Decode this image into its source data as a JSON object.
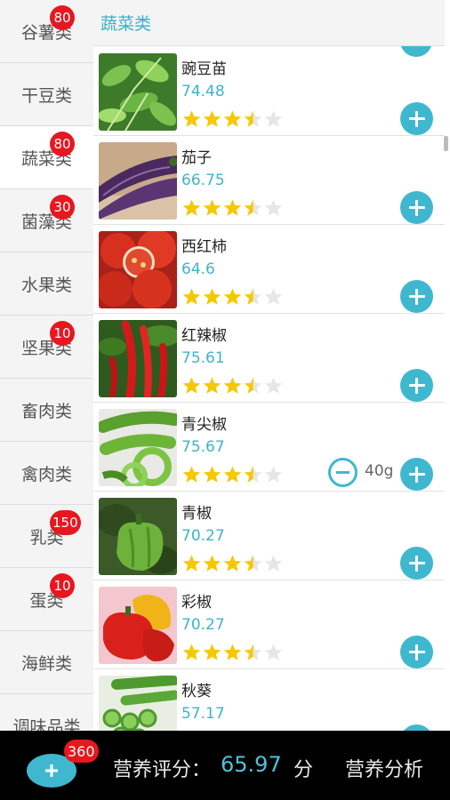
{
  "sidebar": {
    "categories": [
      {
        "label": "谷薯类",
        "badge": "80"
      },
      {
        "label": "干豆类",
        "badge": ""
      },
      {
        "label": "蔬菜类",
        "badge": "80"
      },
      {
        "label": "菌藻类",
        "badge": "30"
      },
      {
        "label": "水果类",
        "badge": ""
      },
      {
        "label": "坚果类",
        "badge": "10"
      },
      {
        "label": "畜肉类",
        "badge": ""
      },
      {
        "label": "禽肉类",
        "badge": ""
      },
      {
        "label": "乳类",
        "badge": "150"
      },
      {
        "label": "蛋类",
        "badge": "10"
      },
      {
        "label": "海鲜类",
        "badge": ""
      },
      {
        "label": "调味品类",
        "badge": ""
      }
    ],
    "active_index": 2
  },
  "main": {
    "section_title": "蔬菜类",
    "items": [
      {
        "name": "豌豆苗",
        "score": "74.48",
        "rating": 3.5
      },
      {
        "name": "茄子",
        "score": "66.75",
        "rating": 3.5
      },
      {
        "name": "西红柿",
        "score": "64.6",
        "rating": 3.5
      },
      {
        "name": "红辣椒",
        "score": "75.61",
        "rating": 3.5
      },
      {
        "name": "青尖椒",
        "score": "75.67",
        "rating": 3.5,
        "quantity": "40g"
      },
      {
        "name": "青椒",
        "score": "70.27",
        "rating": 3.5
      },
      {
        "name": "彩椒",
        "score": "70.27",
        "rating": 3.5
      },
      {
        "name": "秋葵",
        "score": "57.17",
        "rating": 3.5
      }
    ]
  },
  "bottom_bar": {
    "cart_badge": "360",
    "score_label": "营养评分：",
    "score_value": "65.97",
    "score_unit": "分",
    "analysis_label": "营养分析"
  },
  "colors": {
    "accent": "#3fb8cf",
    "badge": "#e8171f",
    "star": "#f6c800",
    "star_empty": "#e6e6e6",
    "bottom_bar": "#000000"
  },
  "icons": {
    "add": "plus-circle-icon",
    "remove": "minus-circle-icon",
    "cart": "tomato-cart-icon",
    "rating": "star-icon"
  }
}
